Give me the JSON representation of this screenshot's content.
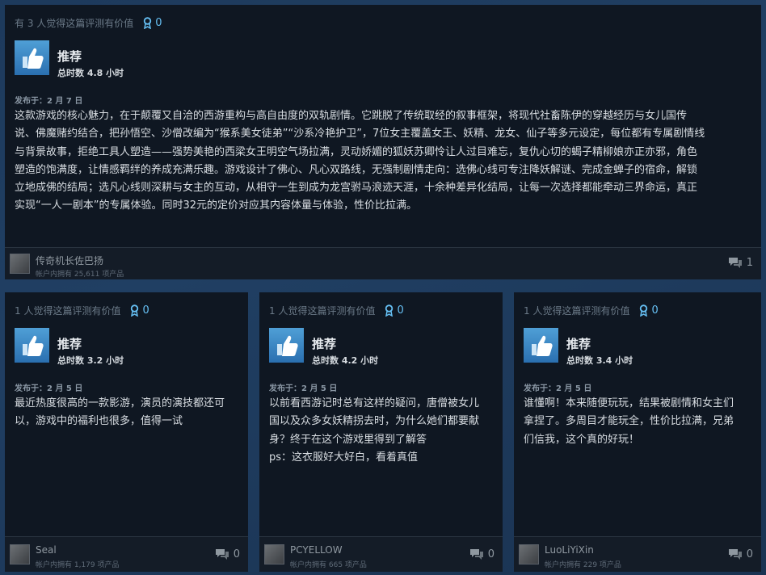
{
  "reviews": [
    {
      "helpful_text": "有 3 人觉得这篇评测有价值",
      "award_count": "0",
      "verdict": "推荐",
      "hours": "总时数 4.8 小时",
      "posted": "发布于：2 月 7 日",
      "body_lines": [
        "这款游戏的核心魅力，在于颠覆又自洽的西游重构与高自由度的双轨剧情。它跳脱了传统取经的叙事框架，将现代社畜陈伊的穿越经历与女儿国传",
        "说、佛魔赌约结合，把孙悟空、沙僧改编为“猴系美女徒弟”“沙系冷艳护卫”，7位女主覆盖女王、妖精、龙女、仙子等多元设定，每位都有专属剧情线",
        "与背景故事，拒绝工具人塑造——强势美艳的西梁女王明空气场拉满，灵动娇媚的狐妖苏卿怜让人过目难忘，复仇心切的蝎子精柳娘亦正亦邪，角色",
        "塑造的饱满度，让情感羁绊的养成充满乐趣。游戏设计了佛心、凡心双路线，无强制剧情走向：选佛心线可专注降妖解谜、完成金蝉子的宿命，解锁",
        "立地成佛的结局；选凡心线则深耕与女主的互动，从相守一生到成为龙宫驸马浪迹天涯，十余种差异化结局，让每一次选择都能牵动三界命运，真正",
        "实现“一人一剧本”的专属体验。同时32元的定价对应其内容体量与体验，性价比拉满。"
      ],
      "user": "传奇机长佐巴扬",
      "owns": "帐户内拥有 25,611 项产品",
      "comment_count": "1"
    },
    {
      "helpful_text": "1 人觉得这篇评测有价值",
      "award_count": "0",
      "verdict": "推荐",
      "hours": "总时数 3.2 小时",
      "posted": "发布于：2 月 5 日",
      "body_lines": [
        "最近热度很高的一款影游，演员的演技都还可",
        "以，游戏中的福利也很多，值得一试"
      ],
      "user": "Seal",
      "owns": "帐户内拥有 1,179 项产品",
      "comment_count": "0"
    },
    {
      "helpful_text": "1 人觉得这篇评测有价值",
      "award_count": "0",
      "verdict": "推荐",
      "hours": "总时数 4.2 小时",
      "posted": "发布于：2 月 5 日",
      "body_lines": [
        "以前看西游记时总有这样的疑问，唐僧被女儿",
        "国以及众多女妖精拐去时，为什么她们都要献",
        "身？终于在这个游戏里得到了解答",
        "ps：这衣服好大好白，看着真值"
      ],
      "user": "PCYELLOW",
      "owns": "帐户内拥有 665 项产品",
      "comment_count": "0"
    },
    {
      "helpful_text": "1 人觉得这篇评测有价值",
      "award_count": "0",
      "verdict": "推荐",
      "hours": "总时数 3.4 小时",
      "posted": "发布于：2 月 5 日",
      "body_lines": [
        "谁懂啊！本来随便玩玩，结果被剧情和女主们",
        "拿捏了。多周目才能玩全，性价比拉满，兄弟",
        "们信我，这个真的好玩！"
      ],
      "user": "LuoLiYiXin",
      "owns": "帐户内拥有 229 项产品",
      "comment_count": "0"
    }
  ],
  "icons": {
    "thumb": "thumbs-up-icon",
    "award": "award-ribbon-icon",
    "comment": "comment-bubble-icon"
  },
  "colors": {
    "accent": "#66c0f4",
    "card_bg": "#0f1722",
    "page_bg": "#1d3a5c"
  }
}
